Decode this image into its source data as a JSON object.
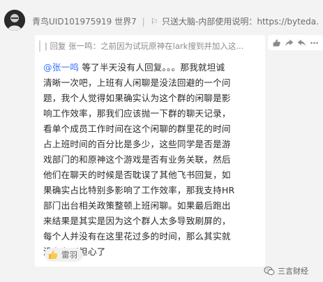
{
  "header": {
    "sender": "青鸟UID101975919 世界7",
    "pinned_text": "只送大脑-内部使用说明：https://byteda...",
    "pin_icon": "flag-icon"
  },
  "quote": {
    "text": "| 回复 张一鸣：之前因为试玩原神在lark搜到并加入这..."
  },
  "message": {
    "mention": "@张一鸣",
    "lines": [
      " 等了半天没有人回复。。。那我就坦诚",
      "清晰一次吧，上班有人闲聊是没法回避的一个问",
      "题，我个人觉得如果确实认为这个群的闲聊是影",
      "响工作效率，那我们应该抛一下群的聊天记录，",
      "看单个成员工作时间在这个闲聊的群里花的时间",
      "占上班时间的百分比是多少，这些同学是否是游",
      "戏部门的和原神这个游戏是否有业务关联，然后",
      "他们在聊天的时候是否耽误了其他飞书回复，如",
      "果确实占比特别多影响了工作效率，那我支持HR",
      "部门出台相关政策整顿上班闲聊。如果最后跑出",
      "来结果是其实是因为这个群人太多导致刷屏的，",
      "每个人并没有在这里花过多的时间，那么其实就",
      "没有必要担心了"
    ]
  },
  "reaction": {
    "emoji": "thumbs-up-icon",
    "who": "雷羽"
  },
  "actions": {
    "items": [
      "thumbs-up-icon",
      "share-icon",
      "reply-icon",
      "more-icon"
    ]
  },
  "watermark": {
    "text": "三言财经",
    "icon": "wechat-logo-icon"
  },
  "colors": {
    "mention": "#3370ff",
    "bubble": "#ffffff",
    "background": "#f3f3f3"
  }
}
